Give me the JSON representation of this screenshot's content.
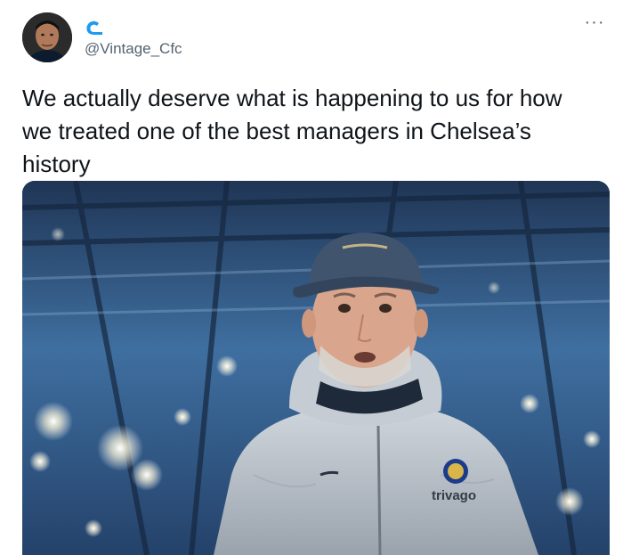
{
  "tweet": {
    "handle": "@Vintage_Cfc",
    "text": "We actually deserve what is happening to us for how\nwe treated one of the best managers in Chelsea’s\nhistory",
    "more_label": "···"
  },
  "icons": {
    "verified": "wave-badge-icon",
    "more": "more-options-icon"
  },
  "media": {
    "jacket_branding": "trivago"
  },
  "colors": {
    "text": "#0f1419",
    "secondary": "#536471",
    "badge": "#1d9bf0"
  }
}
